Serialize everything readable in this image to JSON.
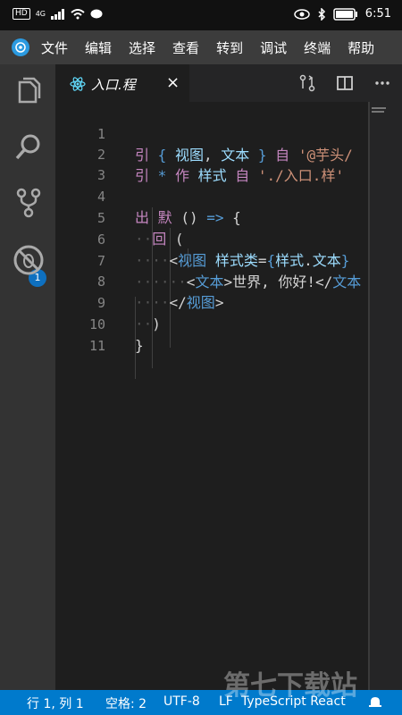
{
  "system_status": {
    "left_badges": [
      "HD",
      "4G"
    ],
    "time": "6:51"
  },
  "menubar": {
    "items": [
      "文件",
      "编辑",
      "选择",
      "查看",
      "转到",
      "调试",
      "终端",
      "帮助"
    ]
  },
  "activity": {
    "source_control_badge": "1"
  },
  "tab": {
    "label": "入口.程",
    "close": "×"
  },
  "editor": {
    "lines": [
      {
        "n": "1"
      },
      {
        "n": "2"
      },
      {
        "n": "3"
      },
      {
        "n": "4"
      },
      {
        "n": "5"
      },
      {
        "n": "6"
      },
      {
        "n": "7"
      },
      {
        "n": "8"
      },
      {
        "n": "9"
      },
      {
        "n": "10"
      },
      {
        "n": "11"
      }
    ],
    "tokens": {
      "l1": [
        "引",
        "{",
        "视图",
        ",",
        "文本",
        "}",
        "自",
        "'@芋头/"
      ],
      "l2": [
        "引",
        "*",
        "作",
        "样式",
        "自",
        "'./入口.样'"
      ],
      "l4": [
        "出",
        "默",
        "()",
        "=>",
        "{"
      ],
      "l5": [
        "回",
        "("
      ],
      "l6": [
        "<",
        "视图",
        "样式类",
        "=",
        "{",
        "样式",
        ".",
        "文本",
        "}"
      ],
      "l7": [
        "<",
        "文本",
        ">",
        "世界, 你好!",
        "</",
        "文本"
      ],
      "l8": [
        "</",
        "视图",
        ">"
      ],
      "l9": [
        ")"
      ],
      "l10": [
        "}"
      ]
    }
  },
  "statusbar": {
    "position": "行 1, 列 1",
    "indent": "空格: 2",
    "encoding": "UTF-8",
    "eol": "LF",
    "language": "TypeScript React"
  },
  "watermark": "第七下载站"
}
